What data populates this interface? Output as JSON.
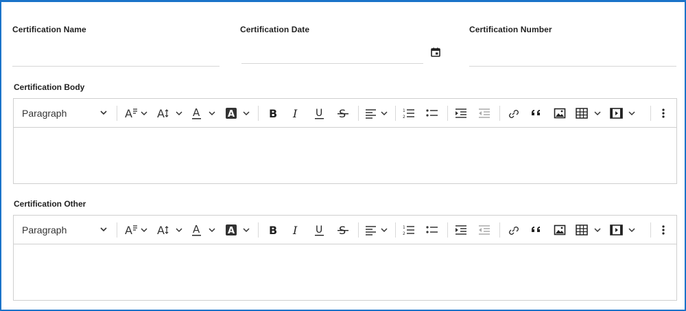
{
  "fields": {
    "name": {
      "label": "Certification Name",
      "value": ""
    },
    "date": {
      "label": "Certification Date",
      "value": ""
    },
    "number": {
      "label": "Certification Number",
      "value": ""
    }
  },
  "editors": [
    {
      "label": "Certification Body",
      "paragraph_label": "Paragraph",
      "content": ""
    },
    {
      "label": "Certification Other",
      "paragraph_label": "Paragraph",
      "content": ""
    }
  ],
  "toolbar_icons": [
    "chevron-down-icon",
    "font-size-icon",
    "line-height-icon",
    "font-color-icon",
    "highlight-color-icon",
    "bold-icon",
    "italic-icon",
    "underline-icon",
    "strikethrough-icon",
    "align-icon",
    "numbered-list-icon",
    "bulleted-list-icon",
    "indent-icon",
    "outdent-icon",
    "link-icon",
    "quote-icon",
    "image-icon",
    "table-icon",
    "media-icon",
    "more-icon"
  ],
  "colors": {
    "accent": "#1a73c9",
    "border": "#cfcfcf",
    "text": "#212121"
  }
}
